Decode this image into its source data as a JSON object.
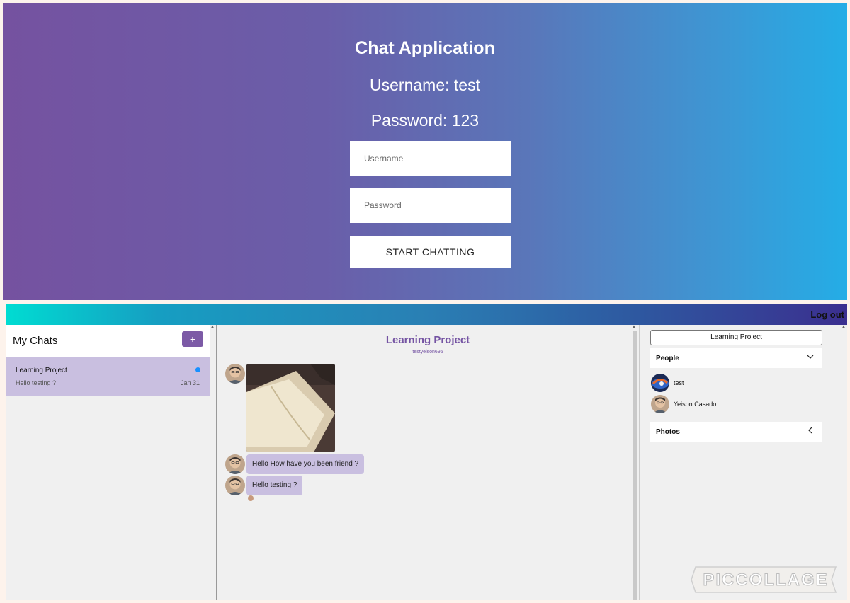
{
  "login": {
    "title": "Chat Application",
    "username_hint": "Username: test",
    "password_hint": "Password: 123",
    "username_placeholder": "Username",
    "password_placeholder": "Password",
    "start_button": "START CHATTING"
  },
  "topbar": {
    "logout_label": "Log out"
  },
  "my_chats": {
    "title": "My Chats",
    "new_chat_label": "+",
    "chats": [
      {
        "title": "Learning Project",
        "last_message": "Hello testing ?",
        "date": "Jan 31",
        "unread": true
      }
    ]
  },
  "feed": {
    "title": "Learning Project",
    "subtitle": "testyeison695",
    "messages": [
      {
        "type": "image",
        "image": "open-book-photo"
      },
      {
        "type": "text",
        "text": "Hello How have you been friend ?"
      },
      {
        "type": "text",
        "text": "Hello testing ?"
      }
    ]
  },
  "settings": {
    "chat_title": "Learning Project",
    "people_label": "People",
    "people": [
      {
        "name": "test"
      },
      {
        "name": "Yeison Casado"
      }
    ],
    "photos_label": "Photos"
  },
  "watermark": "PICCOLLAGE",
  "colors": {
    "accent": "#7c5aa6",
    "bubble": "#c9bfe0",
    "unread_dot": "#1890ff"
  },
  "icons": {
    "people_toggle": "chevron-down-icon",
    "photos_toggle": "chevron-left-icon"
  }
}
